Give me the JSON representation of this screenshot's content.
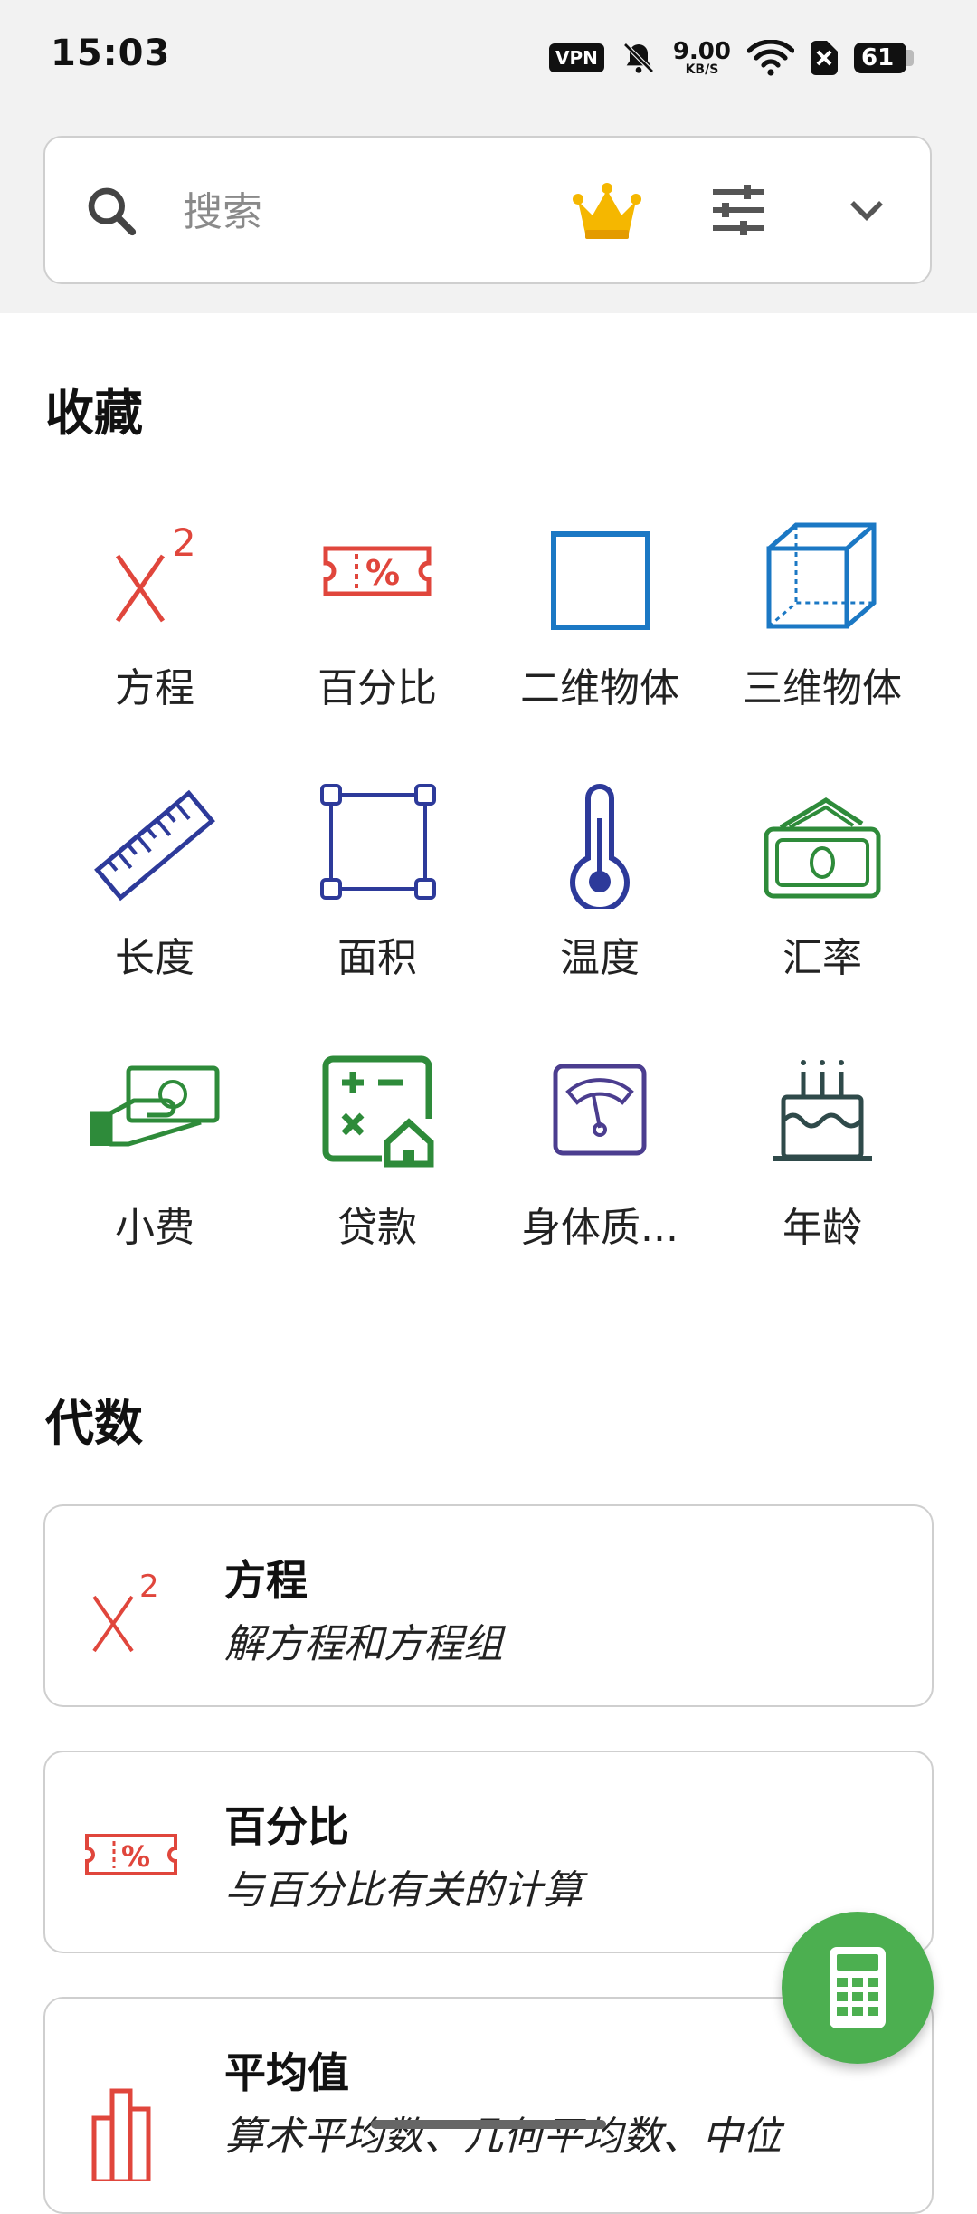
{
  "status_bar": {
    "time": "15:03",
    "vpn": "VPN",
    "speed_value": "9.00",
    "speed_unit": "KB/S",
    "battery": "61",
    "icons": [
      "vpn-icon",
      "bell-muted-icon",
      "network-speed-icon",
      "wifi-icon",
      "sim-disabled-icon",
      "battery-icon"
    ]
  },
  "search": {
    "placeholder": "搜索",
    "icons": [
      "search-icon",
      "crown-icon",
      "filter-icon",
      "chevron-down-icon"
    ],
    "crown_color": "#f5b700"
  },
  "favorites": {
    "title": "收藏",
    "items": [
      {
        "label": "方程",
        "icon": "equation-icon",
        "color": "#e0463c"
      },
      {
        "label": "百分比",
        "icon": "percent-ticket-icon",
        "color": "#e0463c"
      },
      {
        "label": "二维物体",
        "icon": "square-icon",
        "color": "#1b78c4"
      },
      {
        "label": "三维物体",
        "icon": "cube-icon",
        "color": "#1b78c4"
      },
      {
        "label": "长度",
        "icon": "ruler-icon",
        "color": "#2d3a9a"
      },
      {
        "label": "面积",
        "icon": "area-icon",
        "color": "#2d3a9a"
      },
      {
        "label": "温度",
        "icon": "thermometer-icon",
        "color": "#2d3a9a"
      },
      {
        "label": "汇率",
        "icon": "money-icon",
        "color": "#2e8b3a"
      },
      {
        "label": "小费",
        "icon": "tip-hand-icon",
        "color": "#2e8b3a"
      },
      {
        "label": "贷款",
        "icon": "loan-calc-icon",
        "color": "#2e8b3a"
      },
      {
        "label": "身体质...",
        "icon": "scale-icon",
        "color": "#4b3d8f"
      },
      {
        "label": "年龄",
        "icon": "cake-icon",
        "color": "#2f4a4a"
      }
    ]
  },
  "algebra": {
    "title": "代数",
    "cards": [
      {
        "title": "方程",
        "subtitle": "解方程和方程组",
        "icon": "equation-icon"
      },
      {
        "title": "百分比",
        "subtitle": "与百分比有关的计算",
        "icon": "percent-ticket-icon"
      },
      {
        "title": "平均值",
        "subtitle": "算术平均数、几何平均数、中位",
        "icon": "bar-chart-icon"
      }
    ]
  },
  "fab": {
    "icon": "calculator-icon",
    "color": "#4caf50"
  }
}
